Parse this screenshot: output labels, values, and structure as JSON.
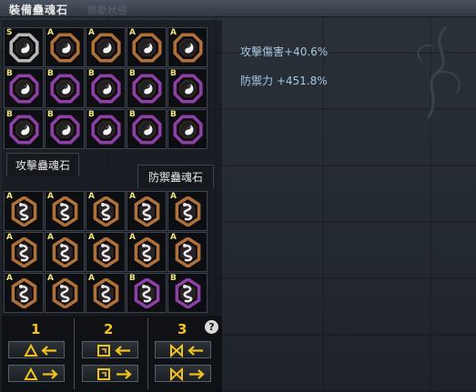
{
  "window": {
    "title": "裝備蠱魂石",
    "ghost_title": "祭斷狀態"
  },
  "tabs": {
    "attack": "攻擊蠱魂石",
    "defense": "防禦蠱魂石"
  },
  "stats": {
    "attack": "攻擊傷害+40.6%",
    "defense": "防禦力 +451.8%"
  },
  "attack_grid": [
    [
      "S",
      "A",
      "A",
      "A",
      "A"
    ],
    [
      "B",
      "B",
      "B",
      "B",
      "B"
    ],
    [
      "B",
      "B",
      "B",
      "B",
      "B"
    ]
  ],
  "attack_frames": [
    [
      "silver",
      "bronze",
      "bronze",
      "bronze",
      "bronze"
    ],
    [
      "purple",
      "purple",
      "purple",
      "purple",
      "purple"
    ],
    [
      "purple",
      "purple",
      "purple",
      "purple",
      "purple"
    ]
  ],
  "defense_grid": [
    [
      "A",
      "A",
      "A",
      "A",
      "A"
    ],
    [
      "A",
      "A",
      "A",
      "A",
      "A"
    ],
    [
      "A",
      "A",
      "A",
      "B",
      "B"
    ]
  ],
  "defense_frames": [
    [
      "bronze",
      "bronze",
      "bronze",
      "bronze",
      "bronze"
    ],
    [
      "bronze",
      "bronze",
      "bronze",
      "bronze",
      "bronze"
    ],
    [
      "bronze",
      "bronze",
      "bronze",
      "purple",
      "purple"
    ]
  ],
  "controls": {
    "columns": [
      {
        "number": "1",
        "icon": "triangle-rune-icon"
      },
      {
        "number": "2",
        "icon": "spiral-rune-icon"
      },
      {
        "number": "3",
        "icon": "bowtie-rune-icon"
      }
    ],
    "help": "?"
  },
  "colors": {
    "accent": "#f2c21b",
    "stat_text": "#a8c8e4",
    "frame_bronze": "#b0703a",
    "frame_purple": "#8e3fa8",
    "frame_silver": "#b8b8b8"
  }
}
